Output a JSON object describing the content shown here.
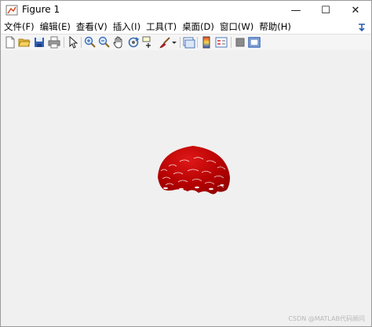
{
  "window": {
    "title": "Figure 1",
    "controls": {
      "minimize": "—",
      "maximize": "☐",
      "close": "✕"
    }
  },
  "menubar": {
    "items": [
      {
        "label": "文件(F)"
      },
      {
        "label": "编辑(E)"
      },
      {
        "label": "查看(V)"
      },
      {
        "label": "插入(I)"
      },
      {
        "label": "工具(T)"
      },
      {
        "label": "桌面(D)"
      },
      {
        "label": "窗口(W)"
      },
      {
        "label": "帮助(H)"
      }
    ]
  },
  "toolbar": {
    "icons": [
      "new-figure-icon",
      "open-file-icon",
      "save-icon",
      "print-icon",
      "select-arrow-icon",
      "zoom-in-icon",
      "zoom-out-icon",
      "pan-hand-icon",
      "rotate-3d-icon",
      "data-cursor-icon",
      "brush-icon",
      "brush-dropdown-icon",
      "link-plot-icon",
      "insert-colorbar-icon",
      "insert-legend-icon",
      "hide-plot-tools-icon",
      "show-plot-tools-icon"
    ]
  },
  "canvas": {
    "watermark": "CSDN @MATLAB代码顾问",
    "plot_colors": {
      "dark": "#7a0000",
      "mid": "#b30000",
      "light": "#e01818"
    }
  }
}
